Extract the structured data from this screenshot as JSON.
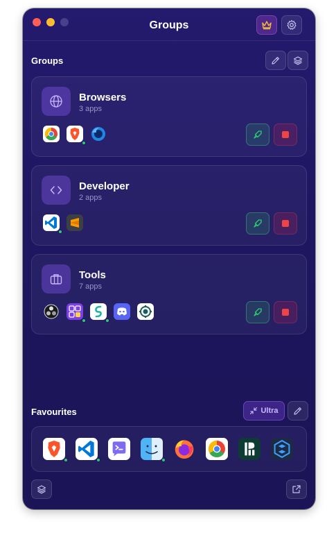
{
  "window": {
    "title": "Groups"
  },
  "groups_section": {
    "label": "Groups"
  },
  "groups": [
    {
      "name": "Browsers",
      "count": "3 apps",
      "icon": "globe-icon",
      "apps": [
        {
          "name": "chrome-icon"
        },
        {
          "name": "brave-icon",
          "running": true
        },
        {
          "name": "firefox-icon"
        }
      ]
    },
    {
      "name": "Developer",
      "count": "2 apps",
      "icon": "code-icon",
      "apps": [
        {
          "name": "vscode-icon",
          "running": true
        },
        {
          "name": "sublime-text-icon"
        }
      ]
    },
    {
      "name": "Tools",
      "count": "7 apps",
      "icon": "briefcase-icon",
      "apps": [
        {
          "name": "obs-icon"
        },
        {
          "name": "grid-app-icon",
          "running": true
        },
        {
          "name": "surfshark-icon",
          "running": true
        },
        {
          "name": "discord-icon"
        },
        {
          "name": "circle-app-icon"
        }
      ]
    }
  ],
  "favourites": {
    "label": "Favourites",
    "ultra_label": "Ultra",
    "apps": [
      {
        "name": "brave-icon",
        "running": true
      },
      {
        "name": "vscode-icon",
        "running": true
      },
      {
        "name": "terminal-chat-icon"
      },
      {
        "name": "finder-icon",
        "running": true
      },
      {
        "name": "firefox-icon"
      },
      {
        "name": "chrome-icon"
      },
      {
        "name": "dashlane-icon"
      },
      {
        "name": "crossover-icon"
      }
    ]
  },
  "colors": {
    "accent": "#7c5cff",
    "launch": "#2ecc71",
    "stop": "#ef4444",
    "running_dot": "#2ecc71"
  }
}
